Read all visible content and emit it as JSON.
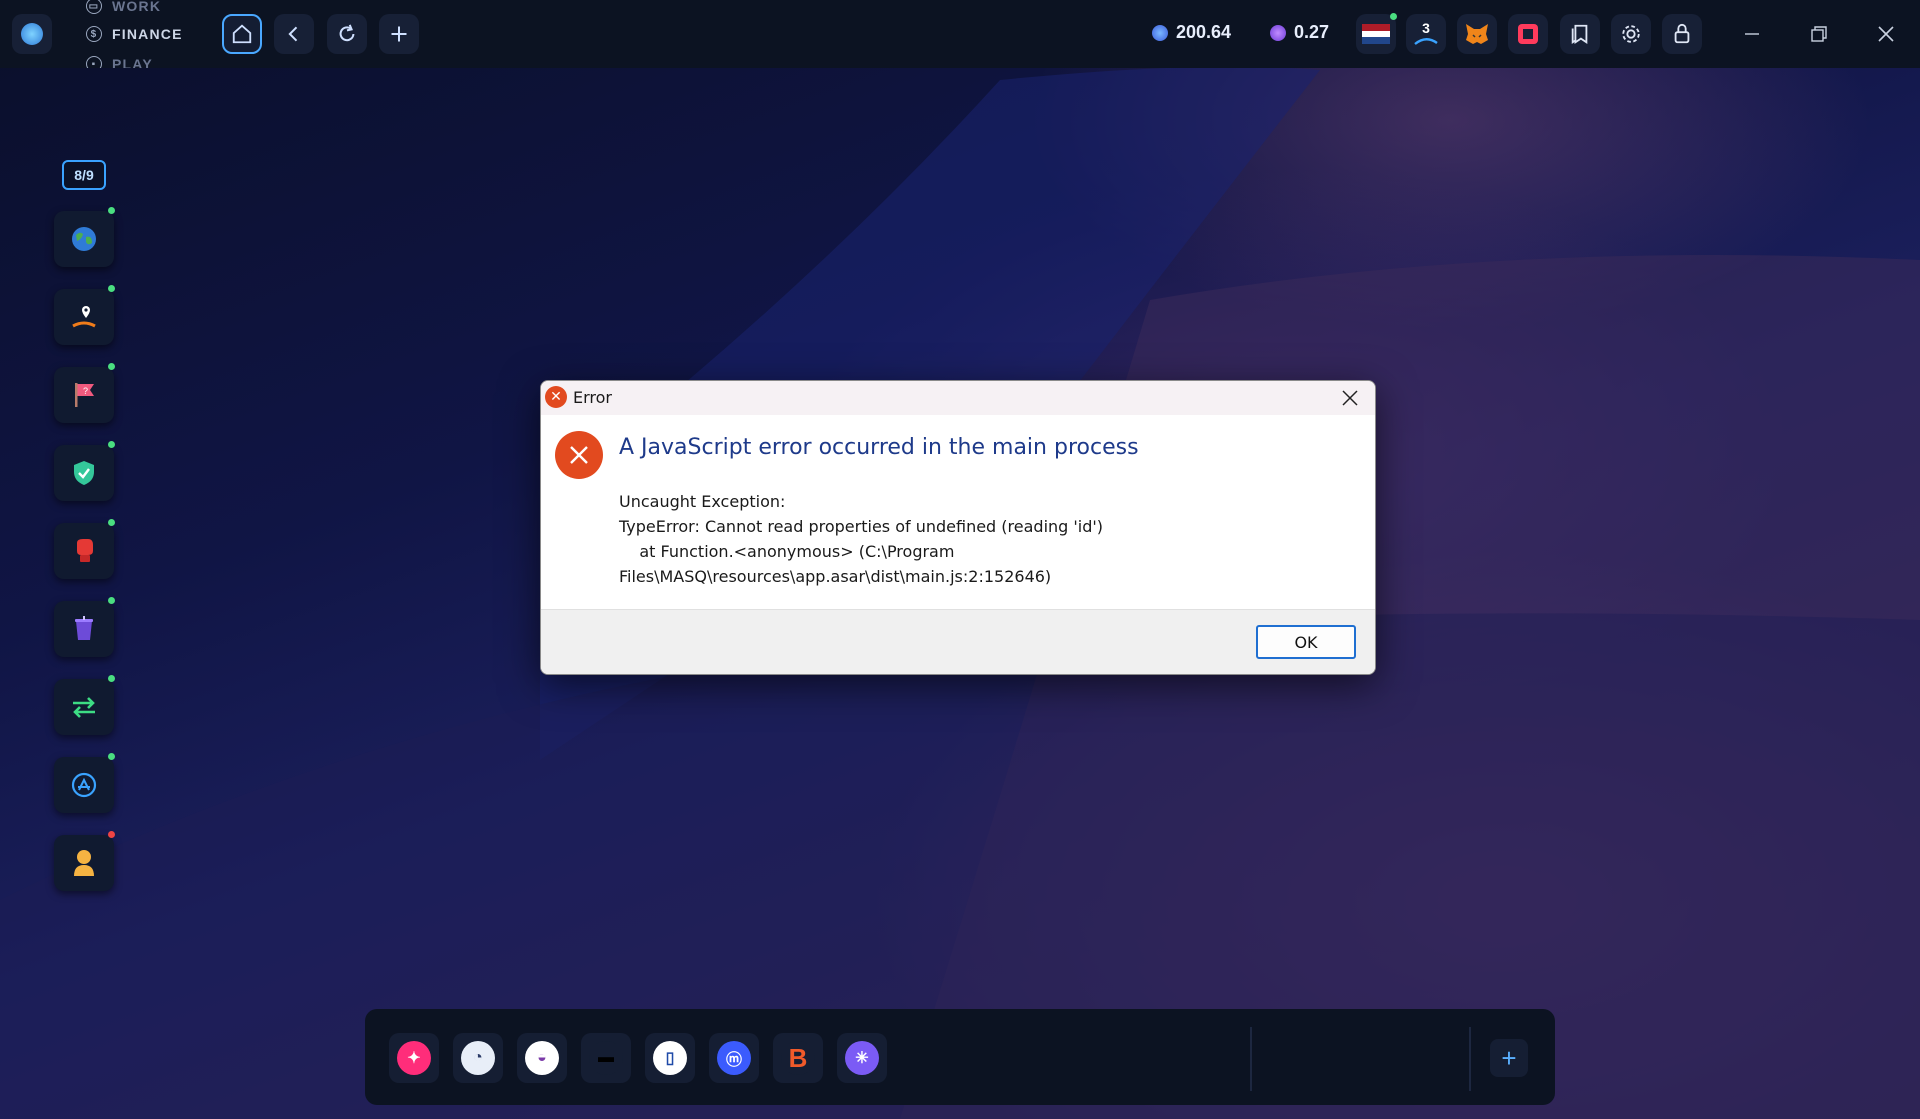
{
  "topbar": {
    "modes": [
      "WORK",
      "FINANCE",
      "PLAY"
    ],
    "balance_1": "200.64",
    "balance_2": "0.27",
    "notification_count": "3"
  },
  "sidebar": {
    "counter": "8/9",
    "items": [
      {
        "icon": "globe-icon",
        "status": "online"
      },
      {
        "icon": "location-pin-icon",
        "status": "online"
      },
      {
        "icon": "flag-icon",
        "status": "online"
      },
      {
        "icon": "shield-icon",
        "status": "online"
      },
      {
        "icon": "boxing-glove-icon",
        "status": "online"
      },
      {
        "icon": "cup-icon",
        "status": "online"
      },
      {
        "icon": "swap-arrows-icon",
        "status": "online"
      },
      {
        "icon": "app-store-icon",
        "status": "online"
      },
      {
        "icon": "person-icon",
        "status": "offline"
      }
    ]
  },
  "dock": {
    "items": [
      "rocket-app-icon",
      "swirl-app-icon",
      "wave-app-icon",
      "hat-app-icon",
      "portal-app-icon",
      "m-app-icon",
      "b-app-icon",
      "snowflake-app-icon"
    ]
  },
  "dialog": {
    "title": "Error",
    "heading": "A JavaScript error occurred in the main process",
    "message": "Uncaught Exception:\nTypeError: Cannot read properties of undefined (reading 'id')\n    at Function.<anonymous> (C:\\Program\nFiles\\MASQ\\resources\\app.asar\\dist\\main.js:2:152646)",
    "ok_label": "OK"
  },
  "colors": {
    "accent": "#4aa8ff",
    "error": "#e24a1f",
    "status_online": "#4ade80",
    "status_offline": "#ef4444"
  }
}
